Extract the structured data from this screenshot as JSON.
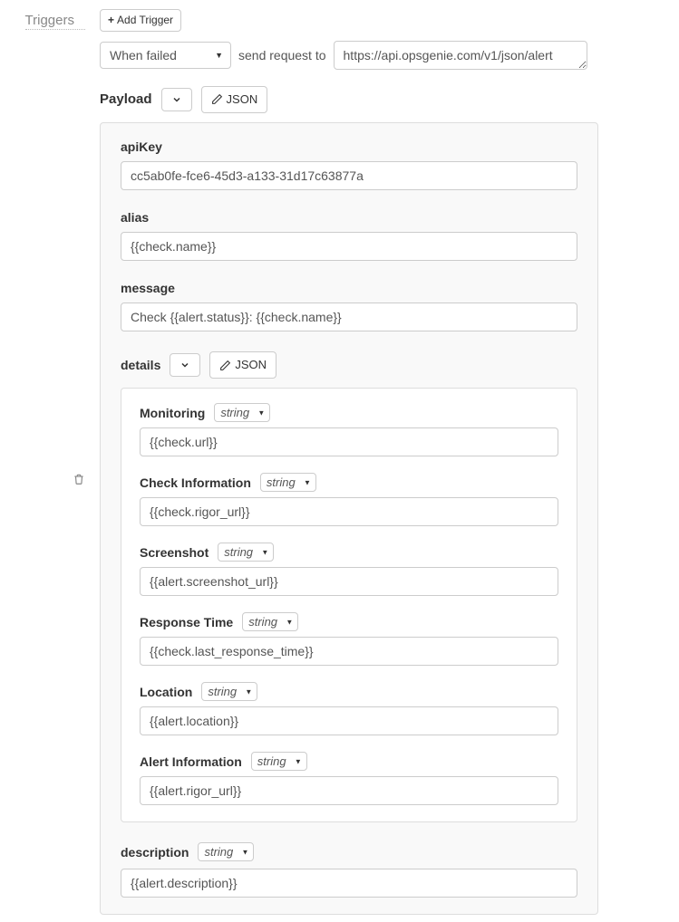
{
  "header": {
    "triggers_label": "Triggers",
    "add_trigger_label": "Add Trigger"
  },
  "trigger": {
    "condition_selected": "When failed",
    "send_request_label": "send request to",
    "url": "https://api.opsgenie.com/v1/json/alert"
  },
  "payload": {
    "title": "Payload",
    "json_button": "JSON",
    "fields": {
      "apiKey": {
        "label": "apiKey",
        "value": "cc5ab0fe-fce6-45d3-a133-31d17c63877a"
      },
      "alias": {
        "label": "alias",
        "value": "{{check.name}}"
      },
      "message": {
        "label": "message",
        "value": "Check {{alert.status}}: {{check.name}}"
      },
      "description": {
        "label": "description",
        "type": "string",
        "value": "{{alert.description}}"
      }
    },
    "details": {
      "title": "details",
      "json_button": "JSON",
      "items": [
        {
          "label": "Monitoring",
          "type": "string",
          "value": "{{check.url}}"
        },
        {
          "label": "Check Information",
          "type": "string",
          "value": "{{check.rigor_url}}"
        },
        {
          "label": "Screenshot",
          "type": "string",
          "value": "{{alert.screenshot_url}}"
        },
        {
          "label": "Response Time",
          "type": "string",
          "value": "{{check.last_response_time}}"
        },
        {
          "label": "Location",
          "type": "string",
          "value": "{{alert.location}}"
        },
        {
          "label": "Alert Information",
          "type": "string",
          "value": "{{alert.rigor_url}}"
        }
      ]
    }
  }
}
